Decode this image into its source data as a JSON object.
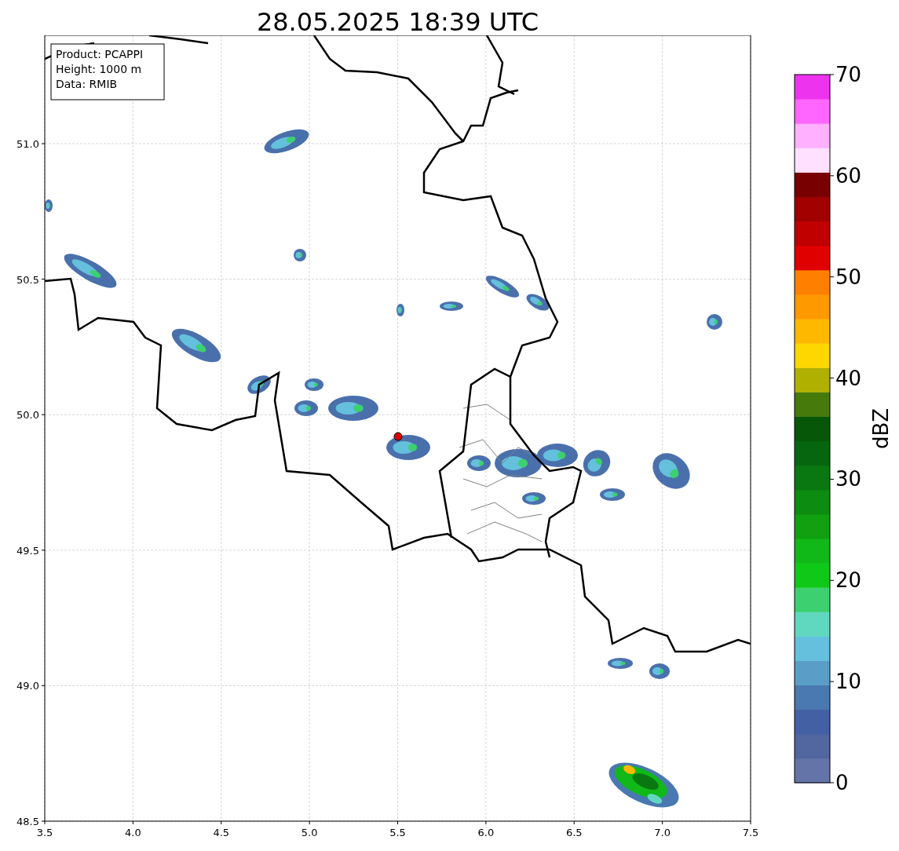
{
  "title": "28.05.2025 18:39 UTC",
  "info_box": [
    "Product: PCAPPI",
    "Height: 1000 m",
    "Data: RMIB"
  ],
  "axes": {
    "xticks": [
      "3.5",
      "4.0",
      "4.5",
      "5.0",
      "5.5",
      "6.0",
      "6.5",
      "7.0",
      "7.5"
    ],
    "yticks": [
      "51.0",
      "50.5",
      "50.0",
      "49.5",
      "49.0",
      "48.5"
    ]
  },
  "colorbar": {
    "label": "dBZ",
    "ticks": [
      "70",
      "60",
      "50",
      "40",
      "30",
      "20",
      "10",
      "0"
    ],
    "bands": [
      {
        "color": "#6574a8"
      },
      {
        "color": "#5266a0"
      },
      {
        "color": "#4460a5"
      },
      {
        "color": "#4a78b0"
      },
      {
        "color": "#5a9ec8"
      },
      {
        "color": "#64c0dc"
      },
      {
        "color": "#60d8c0"
      },
      {
        "color": "#3cd070"
      },
      {
        "color": "#10c818"
      },
      {
        "color": "#10b818"
      },
      {
        "color": "#10a010"
      },
      {
        "color": "#0c8c10"
      },
      {
        "color": "#0a7810"
      },
      {
        "color": "#066610"
      },
      {
        "color": "#065808"
      },
      {
        "color": "#467a0a"
      },
      {
        "color": "#b0b000"
      },
      {
        "color": "#ffd700"
      },
      {
        "color": "#ffb800"
      },
      {
        "color": "#ff9900"
      },
      {
        "color": "#ff8000"
      },
      {
        "color": "#e00000"
      },
      {
        "color": "#c00000"
      },
      {
        "color": "#a00000"
      },
      {
        "color": "#780000"
      },
      {
        "color": "#ffe0ff"
      },
      {
        "color": "#ffb0ff"
      },
      {
        "color": "#ff66ff"
      },
      {
        "color": "#ee33ee"
      }
    ]
  }
}
